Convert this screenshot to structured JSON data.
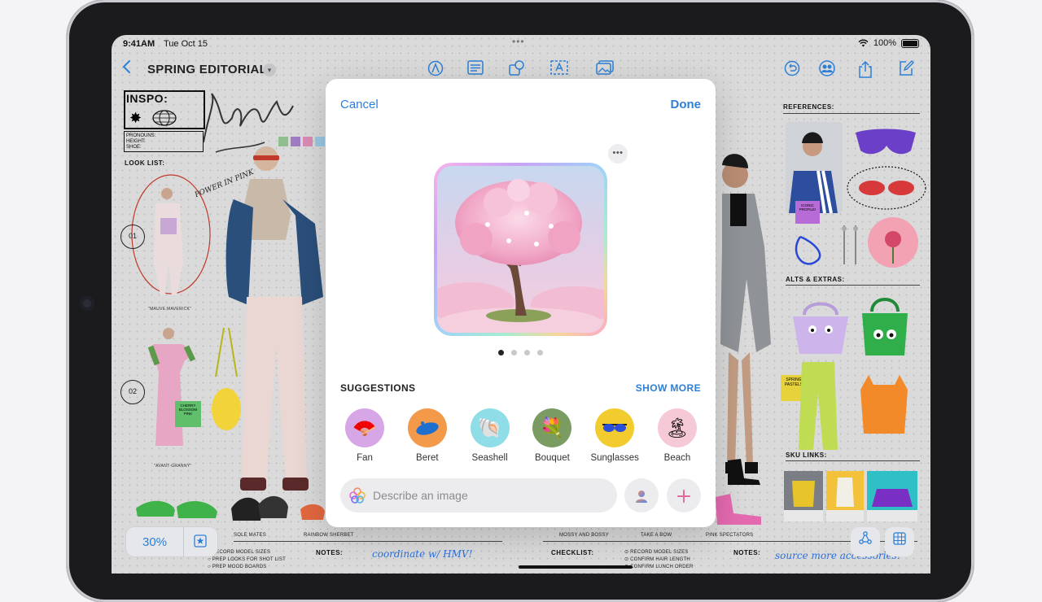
{
  "status": {
    "time": "9:41AM",
    "date": "Tue Oct 15",
    "battery": "100%"
  },
  "toolbar": {
    "title": "SPRING EDITORIAL",
    "icons": [
      "chevron-left-icon",
      "pen-icon",
      "text-block-icon",
      "shapes-icon",
      "text-box-icon",
      "media-icon",
      "undo-icon",
      "collaborate-icon",
      "share-icon",
      "compose-icon"
    ]
  },
  "board": {
    "inspo": "INSPO:",
    "spec_lines": [
      "PRONOUNS:",
      "HEIGHT:",
      "SHOE:"
    ],
    "look_list": "LOOK LIST:",
    "references": "REFERENCES:",
    "alts": "ALTS & EXTRAS:",
    "sku": "SKU LINKS:",
    "num1": "01",
    "num2": "02",
    "cap1": "\"MAUVE MAVERICK\"",
    "cap2": "\"AVANT-GRANNY\"",
    "sticky1": "CHERRY BLOSSOM PINK",
    "sticky2": "SPRING PASTELS",
    "sticky3": "ICONIC PROFILE!",
    "hand1": "POWER IN PINK",
    "bottom_tags": [
      "SOLE MATES",
      "RAINBOW SHERBET",
      "MOSSY AND BOSSY",
      "TAKE A BOW",
      "PINK SPECTATORS"
    ],
    "notes": "NOTES:",
    "checklist": "CHECKLIST:",
    "notes2": "NOTES:",
    "todo_left": [
      "RECORD MODEL SIZES",
      "PREP LOOKS FOR SHOT LIST",
      "PREP MOOD BOARDS"
    ],
    "todo_right": [
      "RECORD MODEL SIZES",
      "CONFIRM HAIR LENGTH",
      "CONFIRM LUNCH ORDER"
    ],
    "handnote_left": "coordinate w/ HMV!",
    "handnote_right": "source more accessories!"
  },
  "zoom": {
    "level": "30%"
  },
  "modal": {
    "cancel": "Cancel",
    "done": "Done",
    "suggestions_label": "SUGGESTIONS",
    "show_more": "SHOW MORE",
    "pages": 4,
    "current_page": 1,
    "suggestions": [
      {
        "label": "Fan",
        "icon": "fan-icon",
        "emoji": "🪭",
        "bg": "#d7a6e6"
      },
      {
        "label": "Beret",
        "icon": "beret-icon",
        "emoji": "🧢",
        "bg": "#f29a4a"
      },
      {
        "label": "Seashell",
        "icon": "seashell-icon",
        "emoji": "🐚",
        "bg": "#8fdde6"
      },
      {
        "label": "Bouquet",
        "icon": "bouquet-icon",
        "emoji": "💐",
        "bg": "#7a9c63"
      },
      {
        "label": "Sunglasses",
        "icon": "sunglasses-icon",
        "emoji": "🕶",
        "bg": "#f2cc2e"
      },
      {
        "label": "Beach",
        "icon": "beach-icon",
        "emoji": "🏝",
        "bg": "#f6c9d6"
      }
    ],
    "prompt_placeholder": "Describe an image",
    "prompt_value": ""
  }
}
